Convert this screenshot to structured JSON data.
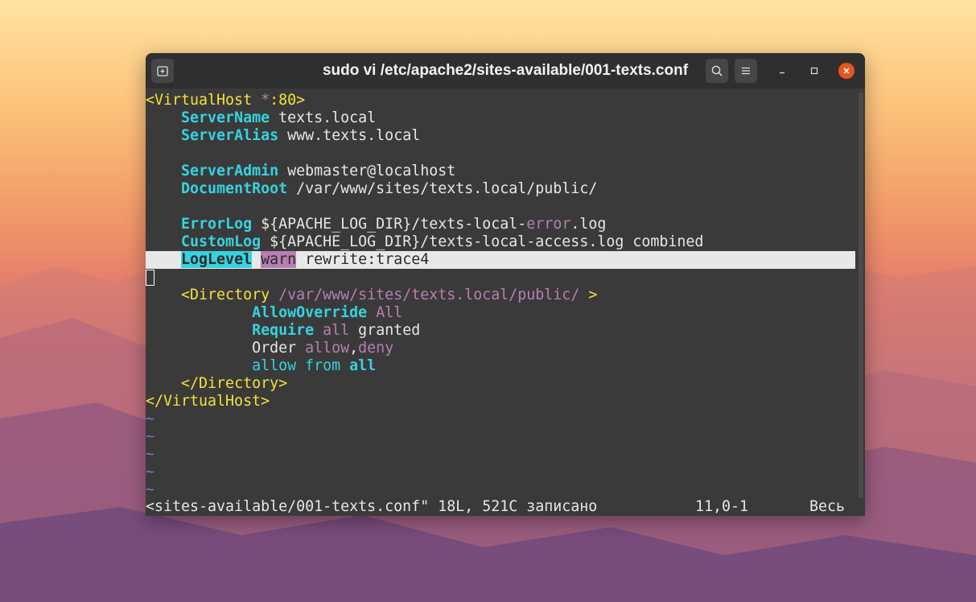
{
  "window": {
    "title": "sudo vi /etc/apache2/sites-available/001-texts.conf"
  },
  "editor": {
    "l1": {
      "a": "<VirtualHost ",
      "b": "*",
      "c": ":80>"
    },
    "l2": {
      "k": "ServerName",
      "v": " texts.local"
    },
    "l3": {
      "k": "ServerAlias",
      "v": " www.texts.local"
    },
    "l5": {
      "k": "ServerAdmin",
      "v": " webmaster@localhost"
    },
    "l6": {
      "k": "DocumentRoot",
      "v": " /var/www/sites/texts.local/public/"
    },
    "l8": {
      "k": "ErrorLog",
      "v1": " ${APACHE_LOG_DIR}/texts-local-",
      "v2": "error",
      "v3": ".log"
    },
    "l9": {
      "k": "CustomLog",
      "v": " ${APACHE_LOG_DIR}/texts-local-access.log combined"
    },
    "l10": {
      "k": "LogLevel",
      "lvl": "warn",
      "v": " rewrite:trace4"
    },
    "l12": {
      "a": "<Directory ",
      "b": "/var/www/sites/texts.local/public/",
      "c": " >"
    },
    "l13": {
      "k": "AllowOverride",
      "v": "All"
    },
    "l14": {
      "k": "Require",
      "v1": "all",
      "v2": " granted"
    },
    "l15": {
      "k": "Order",
      "v1": "allow",
      "v2": ",",
      "v3": "deny"
    },
    "l16": {
      "k": "allow",
      "v1": "from",
      "v2": "all"
    },
    "l17": {
      "a": "</Directory>"
    },
    "l18": {
      "a": "</VirtualHost>"
    },
    "tilde": "~"
  },
  "status": {
    "message": "<sites-available/001-texts.conf\" 18L, 521C записано",
    "position": "11,0-1",
    "scroll": "Весь"
  }
}
